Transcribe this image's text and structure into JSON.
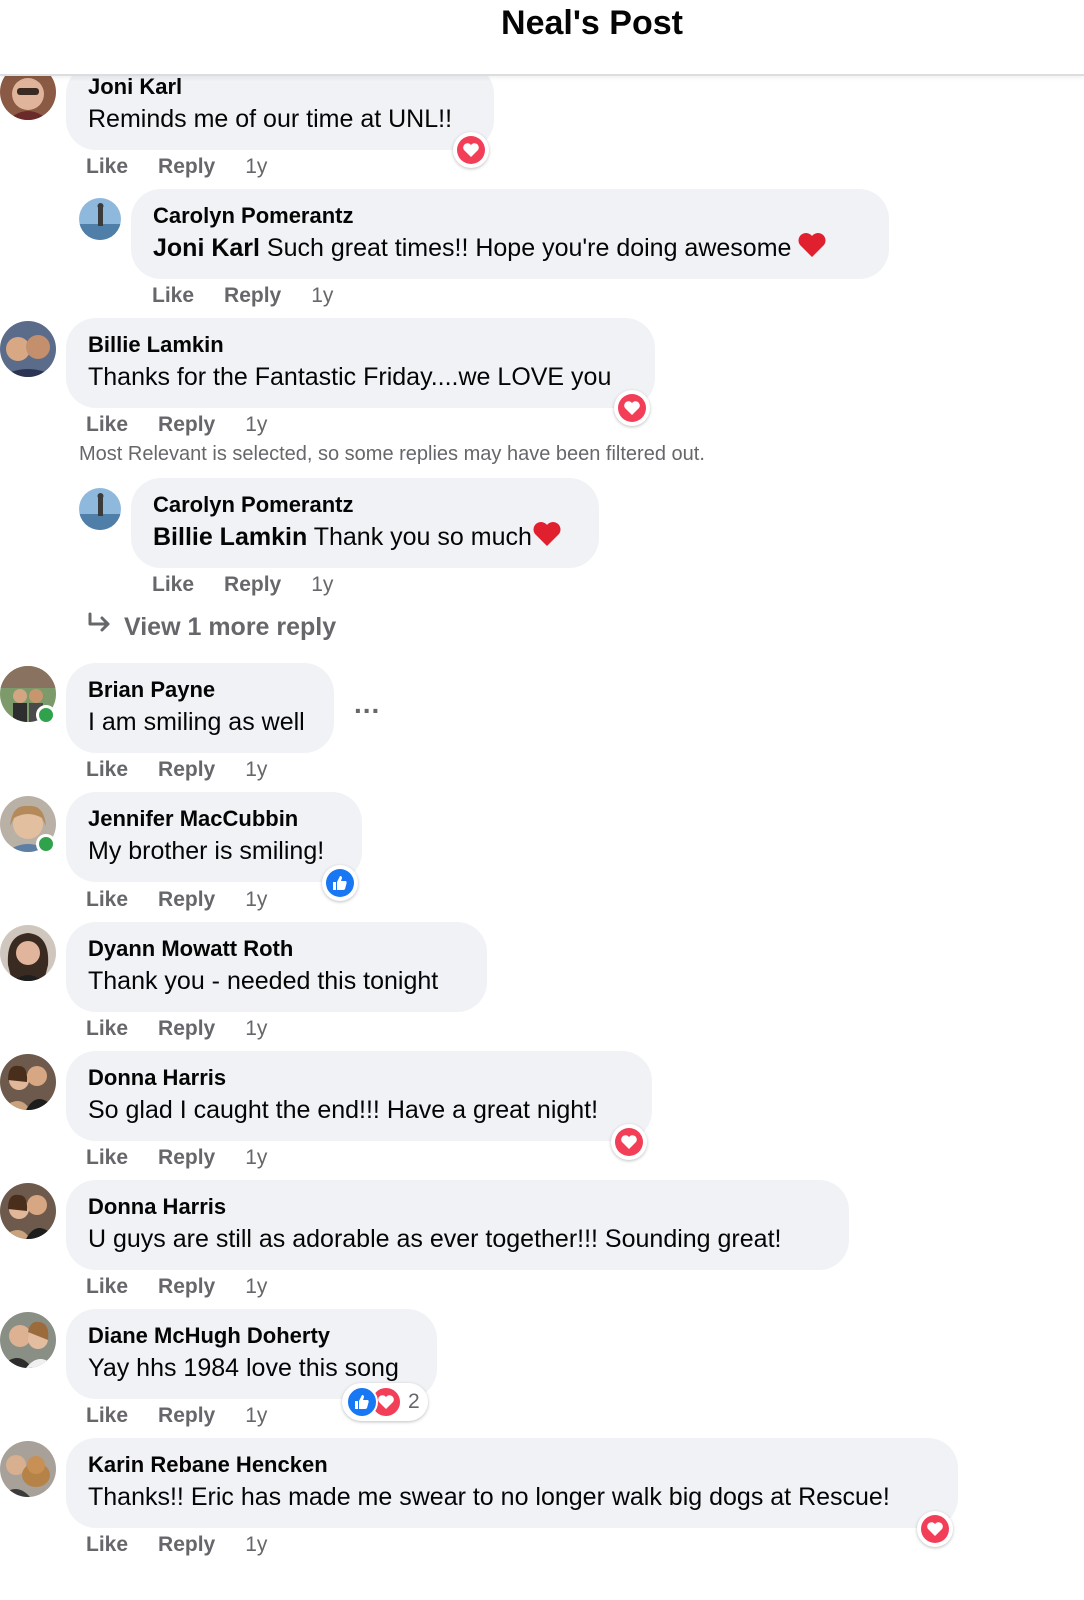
{
  "header": {
    "title": "Neal's Post"
  },
  "actions": {
    "like": "Like",
    "reply": "Reply"
  },
  "comments": [
    {
      "author": "Joni Karl",
      "text": "Reminds me of our time at UNL!!",
      "time": "1y",
      "reaction": "love-icon"
    },
    {
      "author": "Carolyn Pomerantz",
      "mention": "Joni Karl",
      "text": " Such great times!! Hope you're doing awesome",
      "time": "1y"
    },
    {
      "author": "Billie Lamkin",
      "text": "Thanks for the Fantastic Friday....we LOVE you",
      "time": "1y",
      "reaction": "love-icon"
    },
    {
      "author": "Carolyn Pomerantz",
      "mention": "Billie Lamkin",
      "text": " Thank you so much",
      "time": "1y"
    },
    {
      "author": "Brian Payne",
      "text": "I am smiling as well",
      "time": "1y"
    },
    {
      "author": "Jennifer MacCubbin",
      "text": "My brother is smiling!",
      "time": "1y",
      "reaction": "like-icon"
    },
    {
      "author": "Dyann Mowatt Roth",
      "text": "Thank you - needed this tonight",
      "time": "1y"
    },
    {
      "author": "Donna Harris",
      "text": "So glad I caught the end!!! Have a great night!",
      "time": "1y",
      "reaction": "love-icon"
    },
    {
      "author": "Donna Harris",
      "text": "U guys are still as adorable as ever together!!! Sounding great!",
      "time": "1y"
    },
    {
      "author": "Diane McHugh Doherty",
      "text": "Yay hhs 1984 love this song",
      "time": "1y",
      "reaction_count": "2"
    },
    {
      "author": "Karin Rebane Hencken",
      "text": "Thanks!! Eric has made me swear to no longer walk big dogs at Rescue!",
      "time": "1y",
      "reaction": "love-icon"
    }
  ],
  "notice": "Most Relevant is selected, so some replies may have been filtered out.",
  "view_more": "View 1 more reply",
  "more_options": "...",
  "colors": {
    "love": "#f33e58",
    "like": "#1877f2",
    "online": "#31a24c",
    "bubble": "#f0f2f5",
    "meta": "#65676b"
  }
}
